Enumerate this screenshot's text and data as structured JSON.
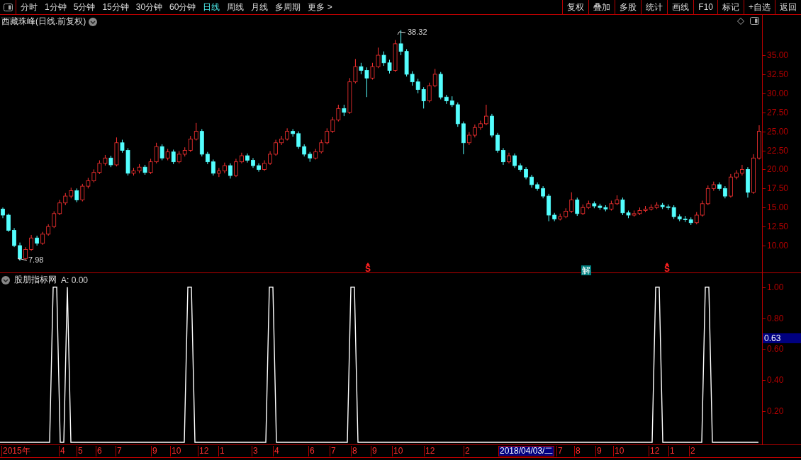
{
  "toolbar": {
    "periods": [
      {
        "label": "分时",
        "selected": false
      },
      {
        "label": "1分钟",
        "selected": false
      },
      {
        "label": "5分钟",
        "selected": false
      },
      {
        "label": "15分钟",
        "selected": false
      },
      {
        "label": "30分钟",
        "selected": false
      },
      {
        "label": "60分钟",
        "selected": false
      },
      {
        "label": "日线",
        "selected": true
      },
      {
        "label": "周线",
        "selected": false
      },
      {
        "label": "月线",
        "selected": false
      },
      {
        "label": "多周期",
        "selected": false
      },
      {
        "label": "更多 >",
        "selected": false
      }
    ],
    "actions": [
      "复权",
      "叠加",
      "多股",
      "统计",
      "画线",
      "F10",
      "标记",
      "+自选",
      "返回"
    ]
  },
  "main_chart": {
    "title": "西藏珠峰(日线.前复权)",
    "high_label": "38.32",
    "low_label": "7.98",
    "signals": [
      {
        "kind": "sell",
        "label": "S"
      },
      {
        "kind": "solve",
        "label": "解"
      },
      {
        "kind": "sell",
        "label": "S"
      }
    ],
    "chart_data": {
      "type": "candlestick",
      "ylim": [
        6.47,
        40.3
      ],
      "yticks": [
        {
          "value": 35,
          "label": "35.00"
        },
        {
          "value": 32.5,
          "label": "32.50"
        },
        {
          "value": 30,
          "label": "30.00"
        },
        {
          "value": 27.5,
          "label": "27.50"
        },
        {
          "value": 25,
          "label": "25.00"
        },
        {
          "value": 22.5,
          "label": "22.50"
        },
        {
          "value": 20,
          "label": "20.00"
        },
        {
          "value": 17.5,
          "label": "17.50"
        },
        {
          "value": 15,
          "label": "15.00"
        },
        {
          "value": 12.5,
          "label": "12.50"
        },
        {
          "value": 10,
          "label": "10.00"
        }
      ],
      "ohlc": [
        [
          14.8,
          15.0,
          13.6,
          14.0
        ],
        [
          14.0,
          14.2,
          11.8,
          12.0
        ],
        [
          12.0,
          12.3,
          9.8,
          10.0
        ],
        [
          10.0,
          10.4,
          8.0,
          8.3
        ],
        [
          8.3,
          9.8,
          8.1,
          9.5
        ],
        [
          9.5,
          11.4,
          9.3,
          11.0
        ],
        [
          11.0,
          11.3,
          10.0,
          10.3
        ],
        [
          10.3,
          11.8,
          10.1,
          11.5
        ],
        [
          11.5,
          12.8,
          11.3,
          12.5
        ],
        [
          12.5,
          14.5,
          12.3,
          14.2
        ],
        [
          14.2,
          16.0,
          14.0,
          15.6
        ],
        [
          15.6,
          16.9,
          15.3,
          16.5
        ],
        [
          16.5,
          17.6,
          16.2,
          17.2
        ],
        [
          17.2,
          17.5,
          15.7,
          16.0
        ],
        [
          16.0,
          18.1,
          15.8,
          17.8
        ],
        [
          17.8,
          18.9,
          17.5,
          18.5
        ],
        [
          18.5,
          20.0,
          18.3,
          19.6
        ],
        [
          19.6,
          21.2,
          19.4,
          20.8
        ],
        [
          20.8,
          21.9,
          20.5,
          21.5
        ],
        [
          21.5,
          21.8,
          20.3,
          20.6
        ],
        [
          20.6,
          24.2,
          20.4,
          23.5
        ],
        [
          23.5,
          23.9,
          22.2,
          22.5
        ],
        [
          22.5,
          22.8,
          19.2,
          19.5
        ],
        [
          19.5,
          20.2,
          19.2,
          19.8
        ],
        [
          19.8,
          20.7,
          19.5,
          20.3
        ],
        [
          20.3,
          20.6,
          19.3,
          19.6
        ],
        [
          19.6,
          21.4,
          19.4,
          21.0
        ],
        [
          21.0,
          23.5,
          20.8,
          23.0
        ],
        [
          23.0,
          23.3,
          21.2,
          21.5
        ],
        [
          21.5,
          22.7,
          21.2,
          22.3
        ],
        [
          22.3,
          22.6,
          20.7,
          21.0
        ],
        [
          21.0,
          22.4,
          20.8,
          22.0
        ],
        [
          22.0,
          22.9,
          21.7,
          22.5
        ],
        [
          22.5,
          24.4,
          22.3,
          24.0
        ],
        [
          24.0,
          26.1,
          23.8,
          25.0
        ],
        [
          25.0,
          25.3,
          21.7,
          22.0
        ],
        [
          22.0,
          22.3,
          20.7,
          21.0
        ],
        [
          21.0,
          21.3,
          19.2,
          19.5
        ],
        [
          19.5,
          20.2,
          19.0,
          19.8
        ],
        [
          19.8,
          20.9,
          19.5,
          20.5
        ],
        [
          20.5,
          20.8,
          18.8,
          19.2
        ],
        [
          19.2,
          21.4,
          19.0,
          21.0
        ],
        [
          21.0,
          22.2,
          20.8,
          21.8
        ],
        [
          21.8,
          22.1,
          20.9,
          21.2
        ],
        [
          21.2,
          21.5,
          20.2,
          20.5
        ],
        [
          20.5,
          20.8,
          19.7,
          20.0
        ],
        [
          20.0,
          21.2,
          19.8,
          20.8
        ],
        [
          20.8,
          22.4,
          20.6,
          22.0
        ],
        [
          22.0,
          23.9,
          21.8,
          23.5
        ],
        [
          23.5,
          24.4,
          23.2,
          24.0
        ],
        [
          24.0,
          25.4,
          23.8,
          25.0
        ],
        [
          25.0,
          25.3,
          24.3,
          24.7
        ],
        [
          24.7,
          25.0,
          22.7,
          23.0
        ],
        [
          23.0,
          23.3,
          21.7,
          22.0
        ],
        [
          22.0,
          22.3,
          21.0,
          21.5
        ],
        [
          21.5,
          22.7,
          21.3,
          22.3
        ],
        [
          22.3,
          23.9,
          22.1,
          23.5
        ],
        [
          23.5,
          25.4,
          23.3,
          25.0
        ],
        [
          25.0,
          26.9,
          24.8,
          26.5
        ],
        [
          26.5,
          28.5,
          26.3,
          28.0
        ],
        [
          28.0,
          28.5,
          27.0,
          27.5
        ],
        [
          27.5,
          32.0,
          27.3,
          31.5
        ],
        [
          31.5,
          34.5,
          31.3,
          33.5
        ],
        [
          33.5,
          34.0,
          32.5,
          33.0
        ],
        [
          33.0,
          33.4,
          29.5,
          32.0
        ],
        [
          32.0,
          34.0,
          31.8,
          33.5
        ],
        [
          33.5,
          36.0,
          33.3,
          35.0
        ],
        [
          35.0,
          35.5,
          33.6,
          34.0
        ],
        [
          34.0,
          34.4,
          32.6,
          33.0
        ],
        [
          33.0,
          37.0,
          32.8,
          36.5
        ],
        [
          36.5,
          38.3,
          35.0,
          35.5
        ],
        [
          35.5,
          35.8,
          32.2,
          32.5
        ],
        [
          32.5,
          32.9,
          31.0,
          31.5
        ],
        [
          31.5,
          31.9,
          30.0,
          30.5
        ],
        [
          30.5,
          30.8,
          28.0,
          29.0
        ],
        [
          29.0,
          31.4,
          28.8,
          31.0
        ],
        [
          31.0,
          33.2,
          30.8,
          32.5
        ],
        [
          32.5,
          32.8,
          29.2,
          29.5
        ],
        [
          29.5,
          29.8,
          28.6,
          29.0
        ],
        [
          29.0,
          29.6,
          28.2,
          28.5
        ],
        [
          28.5,
          28.8,
          25.6,
          26.0
        ],
        [
          26.0,
          26.3,
          22.0,
          23.5
        ],
        [
          23.5,
          24.9,
          23.2,
          24.5
        ],
        [
          24.5,
          25.9,
          24.2,
          25.5
        ],
        [
          25.5,
          26.4,
          25.2,
          26.0
        ],
        [
          26.0,
          28.5,
          25.8,
          27.0
        ],
        [
          27.0,
          27.3,
          24.2,
          24.5
        ],
        [
          24.5,
          24.8,
          22.2,
          22.5
        ],
        [
          22.5,
          22.8,
          20.6,
          21.0
        ],
        [
          21.0,
          22.2,
          20.8,
          21.8
        ],
        [
          21.8,
          22.1,
          20.2,
          20.5
        ],
        [
          20.5,
          20.8,
          19.7,
          20.0
        ],
        [
          20.0,
          20.3,
          18.7,
          19.0
        ],
        [
          19.0,
          19.3,
          17.6,
          18.0
        ],
        [
          18.0,
          18.3,
          17.2,
          17.5
        ],
        [
          17.5,
          17.8,
          16.2,
          16.5
        ],
        [
          16.5,
          16.8,
          13.2,
          14.0
        ],
        [
          14.0,
          14.3,
          13.2,
          13.5
        ],
        [
          13.5,
          14.2,
          13.3,
          13.8
        ],
        [
          13.8,
          14.9,
          13.6,
          14.5
        ],
        [
          14.5,
          17.0,
          14.3,
          16.0
        ],
        [
          16.0,
          16.3,
          13.9,
          14.2
        ],
        [
          14.2,
          15.4,
          14.0,
          15.0
        ],
        [
          15.0,
          15.9,
          14.8,
          15.5
        ],
        [
          15.5,
          15.8,
          14.9,
          15.2
        ],
        [
          15.2,
          15.5,
          14.7,
          15.0
        ],
        [
          15.0,
          15.3,
          14.5,
          14.8
        ],
        [
          14.8,
          15.9,
          14.6,
          15.5
        ],
        [
          15.5,
          16.6,
          15.3,
          16.0
        ],
        [
          16.0,
          16.3,
          14.0,
          14.3
        ],
        [
          14.3,
          14.6,
          13.6,
          14.0
        ],
        [
          14.0,
          14.6,
          13.8,
          14.2
        ],
        [
          14.2,
          15.0,
          14.0,
          14.6
        ],
        [
          14.6,
          15.2,
          14.4,
          14.8
        ],
        [
          14.8,
          15.4,
          14.6,
          15.0
        ],
        [
          15.0,
          15.7,
          14.8,
          15.3
        ],
        [
          15.3,
          15.6,
          14.8,
          15.1
        ],
        [
          15.1,
          15.4,
          14.7,
          15.0
        ],
        [
          15.0,
          15.3,
          13.5,
          13.8
        ],
        [
          13.8,
          14.1,
          13.2,
          13.5
        ],
        [
          13.5,
          13.9,
          13.1,
          13.4
        ],
        [
          13.4,
          13.7,
          12.7,
          13.0
        ],
        [
          13.0,
          14.4,
          12.8,
          14.0
        ],
        [
          14.0,
          15.9,
          13.8,
          15.5
        ],
        [
          15.5,
          17.9,
          15.3,
          17.5
        ],
        [
          17.5,
          18.4,
          17.2,
          18.0
        ],
        [
          18.0,
          18.3,
          17.2,
          17.5
        ],
        [
          17.5,
          17.8,
          16.2,
          16.5
        ],
        [
          16.5,
          19.4,
          16.3,
          19.0
        ],
        [
          19.0,
          19.9,
          18.7,
          19.5
        ],
        [
          19.5,
          20.6,
          19.2,
          20.0
        ],
        [
          20.0,
          20.3,
          16.3,
          17.0
        ],
        [
          17.0,
          22.0,
          16.8,
          21.5
        ],
        [
          21.5,
          25.8,
          21.3,
          25.0
        ]
      ]
    }
  },
  "indicator": {
    "name": "股朋指标网",
    "reading": "A: 0.00",
    "cursor_value": "0.63",
    "chart_data": {
      "type": "line",
      "ylim": [
        0,
        1.09
      ],
      "yticks": [
        {
          "value": 1,
          "label": "1.00"
        },
        {
          "value": 0.8,
          "label": "0.80"
        },
        {
          "value": 0.6,
          "label": "0.60"
        },
        {
          "value": 0.4,
          "label": "0.40"
        },
        {
          "value": 0.2,
          "label": "0.20"
        }
      ],
      "series": [
        {
          "color": "#ffffff",
          "values": [
            0,
            0,
            0,
            0,
            0,
            0,
            0,
            0,
            0,
            0,
            0,
            0,
            0,
            0,
            0,
            1,
            1,
            0,
            0,
            1,
            0,
            0,
            0,
            0,
            0,
            0,
            0,
            0,
            0,
            0,
            0,
            0,
            0,
            0,
            0,
            0,
            0,
            0,
            0,
            0,
            0,
            0,
            0,
            0,
            0,
            0,
            0,
            0,
            0,
            0,
            0,
            0,
            0,
            1,
            1,
            0,
            0,
            0,
            0,
            0,
            0,
            0,
            0,
            0,
            0,
            0,
            0,
            0,
            0,
            0,
            0,
            0,
            0,
            0,
            0,
            0,
            1,
            1,
            0,
            0,
            0,
            0,
            0,
            0,
            0,
            0,
            0,
            0,
            0,
            0,
            0,
            0,
            0,
            0,
            0,
            0,
            0,
            0,
            0,
            1,
            1,
            0,
            0,
            0,
            0,
            0,
            0,
            0,
            0,
            0,
            0,
            0,
            0,
            0,
            0,
            0,
            0,
            0,
            0,
            0,
            0,
            0,
            0,
            0,
            0,
            0,
            0,
            0,
            0,
            0,
            0,
            0,
            0,
            0,
            0,
            0,
            0,
            0,
            0,
            0,
            0,
            0,
            0,
            0,
            0,
            0,
            0,
            0,
            0,
            0,
            0,
            0,
            0,
            0,
            0,
            0,
            0,
            0,
            0,
            0,
            0,
            0,
            0,
            0,
            0,
            0,
            0,
            0,
            0,
            0,
            0,
            0,
            0,
            0,
            0,
            0,
            0,
            0,
            0,
            0,
            0,
            0,
            0,
            0,
            0,
            1,
            1,
            0,
            0,
            0,
            0,
            0,
            0,
            0,
            0,
            0,
            0,
            0,
            0,
            1,
            1,
            0,
            0,
            0,
            0,
            0,
            0,
            0,
            0,
            0,
            0,
            0,
            0,
            0,
            0
          ]
        }
      ]
    }
  },
  "date_axis": {
    "labels": [
      "2015年",
      "4",
      "5",
      "6",
      "7",
      "9",
      "10",
      "12",
      "1",
      "3",
      "4",
      "6",
      "7",
      "8",
      "9",
      "10",
      "12",
      "2",
      "7",
      "8",
      "9",
      "10",
      "12",
      "1",
      "2"
    ],
    "cursor_date": "2018/04/03/二"
  }
}
